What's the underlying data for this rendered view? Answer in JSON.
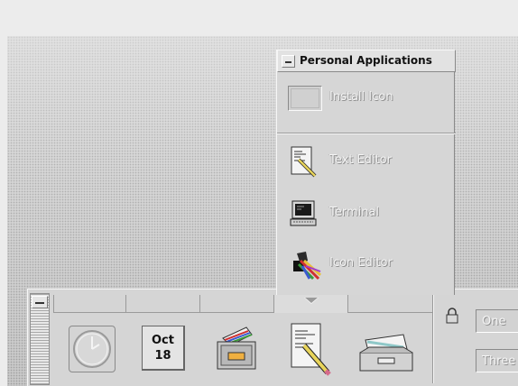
{
  "subpanel": {
    "title": "Personal Applications",
    "items": [
      {
        "label": "Install Icon",
        "icon": "install-icon"
      },
      {
        "label": "Text Editor",
        "icon": "text-editor-icon"
      },
      {
        "label": "Terminal",
        "icon": "terminal-icon"
      },
      {
        "label": "Icon Editor",
        "icon": "icon-editor-icon"
      }
    ]
  },
  "front_panel": {
    "controls": [
      {
        "name": "clock",
        "icon": "clock-icon"
      },
      {
        "name": "calendar",
        "icon": "calendar-icon",
        "month": "Oct",
        "day": "18"
      },
      {
        "name": "file-manager",
        "icon": "file-manager-icon"
      },
      {
        "name": "text-editor",
        "icon": "text-editor-icon"
      },
      {
        "name": "mail",
        "icon": "mail-icon"
      }
    ],
    "workspaces": [
      "One",
      "Three"
    ]
  },
  "colors": {
    "panel": "#d5d5d5",
    "label_emboss": "#f5f5f5",
    "desktop_dot": "#a9a9a9"
  }
}
